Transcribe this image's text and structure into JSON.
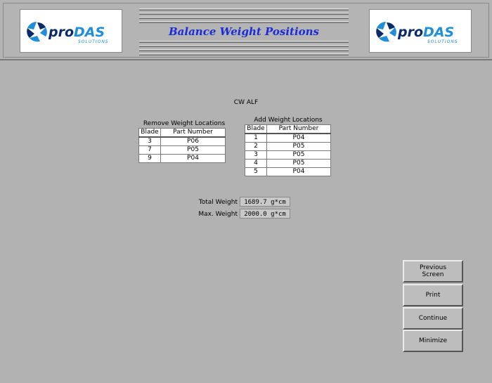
{
  "header": {
    "title": "Balance Weight Positions",
    "logo_left": {
      "pro": "pro",
      "das": "DAS",
      "sub": "SOLUTIONS"
    },
    "logo_right": {
      "pro": "pro",
      "das": "DAS",
      "sub": "SOLUTIONS"
    }
  },
  "main": {
    "mode_label": "CW ALF",
    "remove_table": {
      "title": "Remove Weight Locations",
      "headers": [
        "Blade",
        "Part Number"
      ],
      "rows": [
        {
          "blade": "3",
          "part": "P06"
        },
        {
          "blade": "7",
          "part": "P05"
        },
        {
          "blade": "9",
          "part": "P04"
        }
      ]
    },
    "add_table": {
      "title": "Add Weight Locations",
      "headers": [
        "Blade",
        "Part Number"
      ],
      "rows": [
        {
          "blade": "1",
          "part": "P04"
        },
        {
          "blade": "2",
          "part": "P05"
        },
        {
          "blade": "3",
          "part": "P05"
        },
        {
          "blade": "4",
          "part": "P05"
        },
        {
          "blade": "5",
          "part": "P04"
        }
      ]
    },
    "total_weight_label": "Total Weight",
    "total_weight_value": "1689.7  g*cm",
    "max_weight_label": "Max. Weight",
    "max_weight_value": "2000.0  g*cm"
  },
  "buttons": {
    "previous": "Previous\nScreen",
    "print": "Print",
    "continue": "Continue",
    "minimize": "Minimize"
  },
  "colors": {
    "background": "#b2b2b2",
    "title_blue": "#1a2cd6",
    "logo_dark": "#0b2a6b",
    "logo_light": "#1e8fd8"
  }
}
